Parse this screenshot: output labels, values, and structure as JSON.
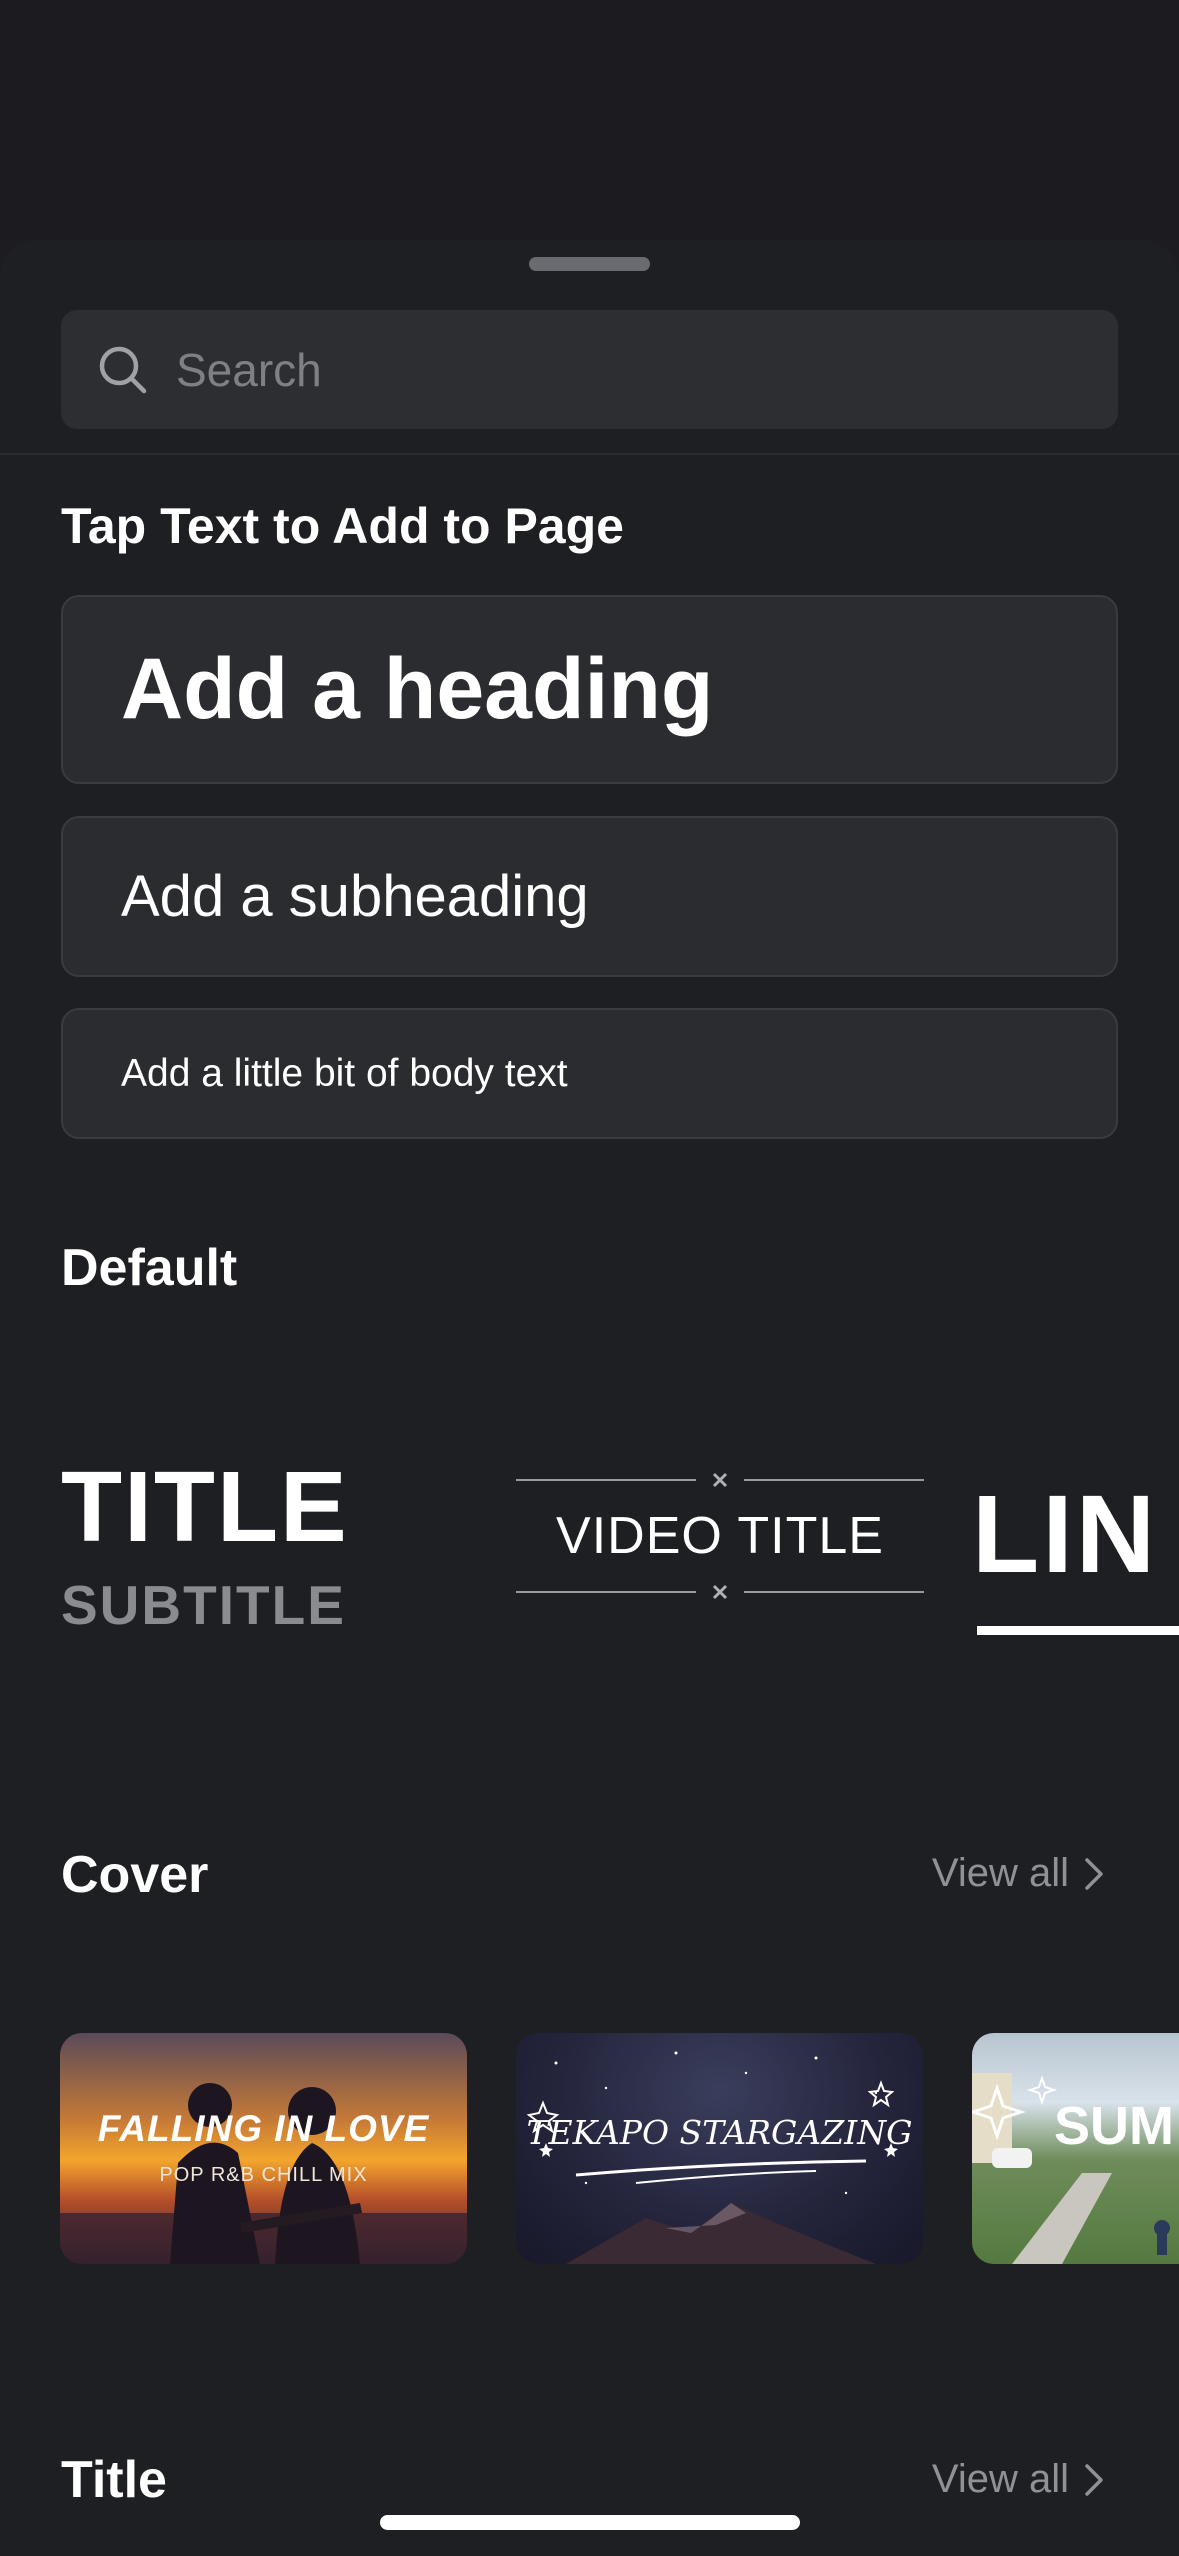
{
  "search": {
    "placeholder": "Search"
  },
  "sections": {
    "tap_text": {
      "title": "Tap Text to Add to Page",
      "heading": "Add a heading",
      "subheading": "Add a subheading",
      "body": "Add a little bit of body text"
    },
    "default": {
      "title": "Default",
      "items": {
        "title_style": {
          "title": "TITLE",
          "subtitle": "SUBTITLE"
        },
        "video_title": "VIDEO TITLE",
        "line_style": "LIN"
      }
    },
    "cover": {
      "title": "Cover",
      "view_all": "View all",
      "items": [
        {
          "title": "FALLING IN LOVE",
          "subtitle": "POP R&B CHILL MIX"
        },
        {
          "title": "TEKAPO STARGAZING"
        },
        {
          "title": "SUM"
        }
      ]
    },
    "title_section": {
      "title": "Title",
      "view_all": "View all"
    }
  }
}
